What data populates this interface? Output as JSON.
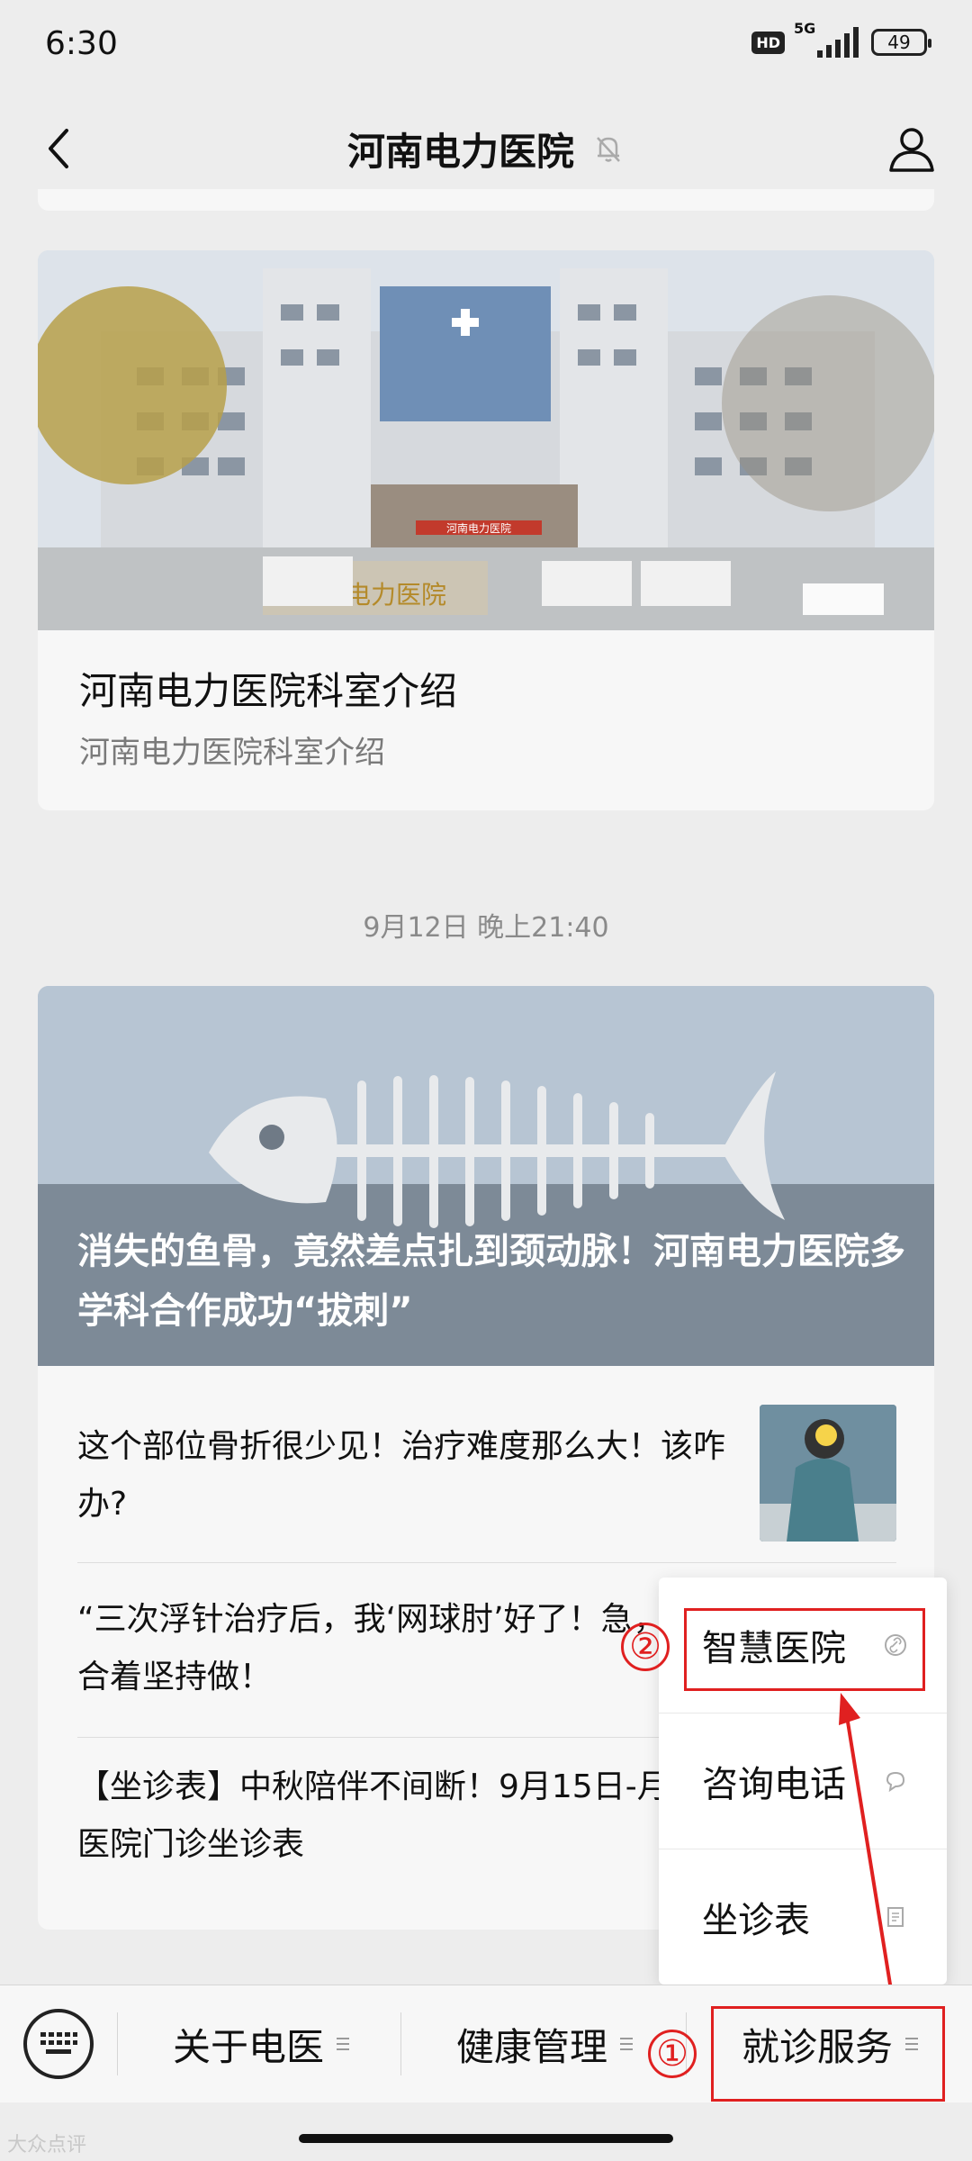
{
  "status_bar": {
    "time": "6:30",
    "hd": "HD",
    "network": "5G",
    "battery": "49"
  },
  "nav": {
    "title": "河南电力医院"
  },
  "card1": {
    "title": "河南电力医院科室介绍",
    "subtitle": "河南电力医院科室介绍",
    "building_sign": "河南电力医院",
    "gate_sign": "河南电力医院"
  },
  "timestamp": "9月12日 晚上21:40",
  "card2": {
    "headline": "消失的鱼骨，竟然差点扎到颈动脉！河南电力医院多学科合作成功“拔刺”",
    "articles": [
      "这个部位骨折很少见！治疗难度那么大！该咋办?",
      "“三次浮针治疗后，我‘网球肘’好了！急，康复运动也要配合着坚持做！",
      "【坐诊表】中秋陪伴不间断！9月15日-月21日河南电力医院门诊坐诊表"
    ]
  },
  "popup_menu": {
    "items": [
      {
        "label": "智慧医院",
        "icon": "link-icon"
      },
      {
        "label": "咨询电话",
        "icon": "chat-bubble-icon"
      },
      {
        "label": "坐诊表",
        "icon": "document-icon"
      }
    ]
  },
  "bottom_menu": {
    "tabs": [
      "关于电医",
      "健康管理",
      "就诊服务"
    ]
  },
  "annotations": {
    "step1": "①",
    "step2": "②",
    "color": "#e02020"
  },
  "watermark": "大众点评"
}
